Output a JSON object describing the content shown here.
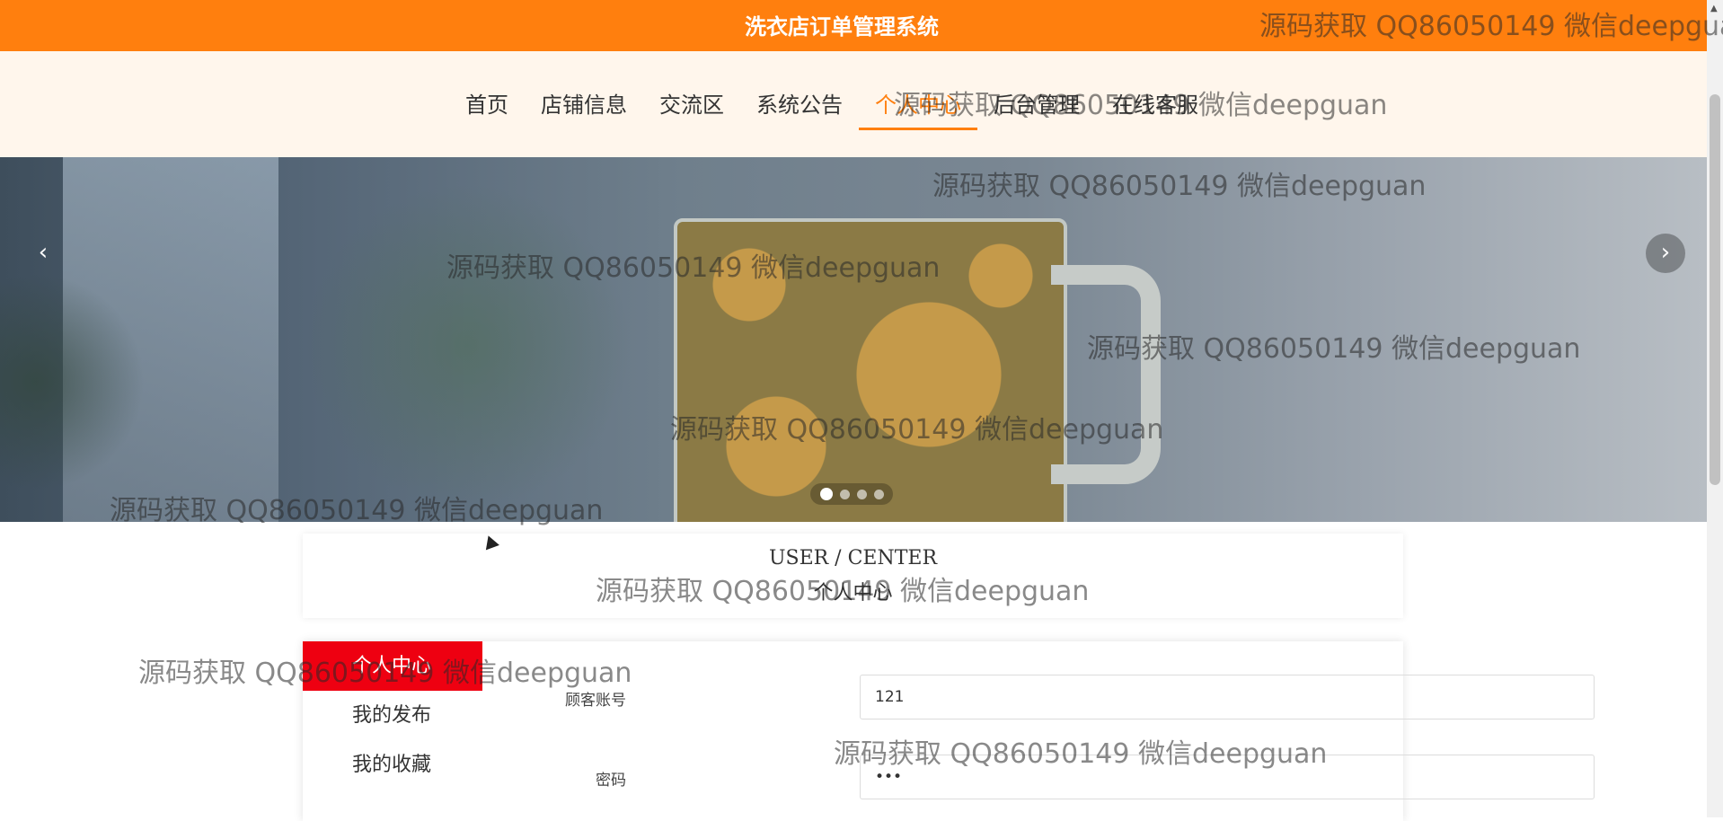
{
  "header": {
    "title": "洗衣店订单管理系统"
  },
  "nav": {
    "items": [
      {
        "label": "首页"
      },
      {
        "label": "店铺信息"
      },
      {
        "label": "交流区"
      },
      {
        "label": "系统公告"
      },
      {
        "label": "个人中心"
      },
      {
        "label": "后台管理"
      },
      {
        "label": "在线客服"
      }
    ],
    "active_index": 4
  },
  "banner": {
    "slide_count": 4,
    "active_slide": 1,
    "prev_icon": "chevron-left-icon",
    "next_icon": "chevron-right-icon"
  },
  "section": {
    "title_en": "USER / CENTER",
    "title_cn": "个人中心"
  },
  "sidebar": {
    "items": [
      {
        "label": "个人中心"
      },
      {
        "label": "我的发布"
      },
      {
        "label": "我的收藏"
      }
    ]
  },
  "form": {
    "account": {
      "label": "顾客账号",
      "value": "121"
    },
    "password": {
      "label": "密码",
      "value": "•••"
    }
  },
  "watermark": {
    "text": "源码获取 QQ86050149 微信deepguan",
    "text_truncated": "源码获取 QQ86050149 微信deepgua"
  },
  "colors": {
    "primary": "#ff7f0e",
    "nav_bg": "#fff6ec",
    "sidebar_active": "#ee0011"
  }
}
